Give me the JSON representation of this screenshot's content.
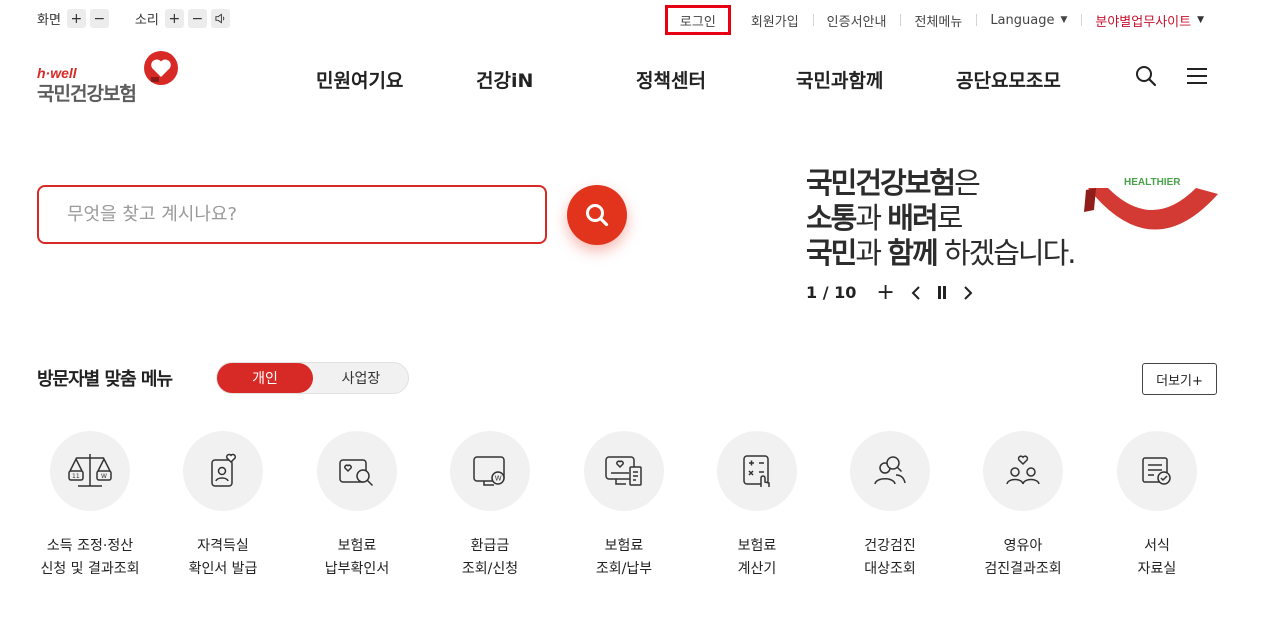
{
  "util_left": {
    "screen_label": "화면",
    "sound_label": "소리",
    "plus": "+",
    "minus": "−"
  },
  "util_right": {
    "login": "로그인",
    "join": "회원가입",
    "cert": "인증서안내",
    "sitemap": "전체메뉴",
    "language": "Language",
    "field_sites": "분야별업무사이트"
  },
  "logo": {
    "hwell": "h·well",
    "name": "국민건강보험"
  },
  "gnb": [
    "민원여기요",
    "건강iN",
    "정책센터",
    "국민과함께",
    "공단요모조모"
  ],
  "search": {
    "placeholder": "무엇을 찾고 계시나요?"
  },
  "banner": {
    "line1_bold": "국민건강보험",
    "line1_light": "은",
    "line2_bold1": "소통",
    "line2_light1": "과 ",
    "line2_bold2": "배려",
    "line2_light2": "로",
    "line3_bold1": "국민",
    "line3_light1": "과 ",
    "line3_bold2": "함께",
    "line3_light2": " 하겠습니다.",
    "healthier": "HEALTHIER",
    "counter": "1 / 10",
    "plus": "+"
  },
  "visitor_menu": {
    "title": "방문자별 맞춤 메뉴",
    "tab_personal": "개인",
    "tab_business": "사업장",
    "more": "더보기+",
    "items": [
      {
        "line1": "소득 조정·정산",
        "line2": "신청 및 결과조회",
        "icon": "scale-icon"
      },
      {
        "line1": "자격득실",
        "line2": "확인서 발급",
        "icon": "id-card-heart-icon"
      },
      {
        "line1": "보험료",
        "line2": "납부확인서",
        "icon": "card-search-icon"
      },
      {
        "line1": "환급금",
        "line2": "조회/신청",
        "icon": "monitor-won-icon"
      },
      {
        "line1": "보험료",
        "line2": "조회/납부",
        "icon": "monitor-receipt-icon"
      },
      {
        "line1": "보험료",
        "line2": "계산기",
        "icon": "calculator-icon"
      },
      {
        "line1": "건강검진",
        "line2": "대상조회",
        "icon": "people-search-icon"
      },
      {
        "line1": "영유아",
        "line2": "검진결과조회",
        "icon": "family-heart-icon"
      },
      {
        "line1": "서식",
        "line2": "자료실",
        "icon": "document-check-icon"
      }
    ]
  },
  "colors": {
    "brand_red": "#d72a26",
    "search_btn": "#e2341d",
    "login_border": "#e60012"
  }
}
